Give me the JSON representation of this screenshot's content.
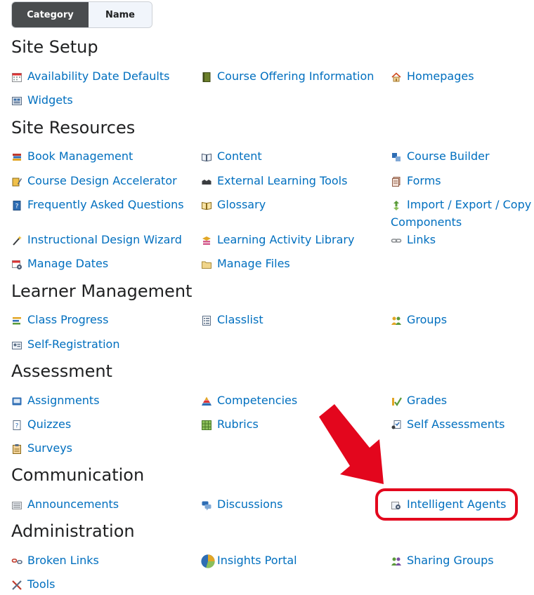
{
  "toggle": {
    "category": "Category",
    "name": "Name"
  },
  "sections": {
    "site_setup": {
      "title": "Site Setup",
      "items": [
        "Availability Date Defaults",
        "Course Offering Information",
        "Homepages",
        "Widgets"
      ]
    },
    "site_resources": {
      "title": "Site Resources",
      "items": [
        "Book Management",
        "Content",
        "Course Builder",
        "Course Design Accelerator",
        "External Learning Tools",
        "Forms",
        "Frequently Asked Questions",
        "Glossary",
        "Import / Export / Copy",
        "Components",
        "Instructional Design Wizard",
        "Learning Activity Library",
        "Links",
        "Manage Dates",
        "Manage Files"
      ]
    },
    "learner_management": {
      "title": "Learner Management",
      "items": [
        "Class Progress",
        "Classlist",
        "Groups",
        "Self-Registration"
      ]
    },
    "assessment": {
      "title": "Assessment",
      "items": [
        "Assignments",
        "Competencies",
        "Grades",
        "Quizzes",
        "Rubrics",
        "Self Assessments",
        "Surveys"
      ]
    },
    "communication": {
      "title": "Communication",
      "items": [
        "Announcements",
        "Discussions",
        "Intelligent Agents"
      ]
    },
    "administration": {
      "title": "Administration",
      "items": [
        "Broken Links",
        "Insights Portal",
        "Sharing Groups",
        "Tools"
      ]
    }
  },
  "colors": {
    "link": "#006fbf",
    "heading": "#202122",
    "highlight": "#e3061d",
    "toggle_active": "#494c4e"
  }
}
